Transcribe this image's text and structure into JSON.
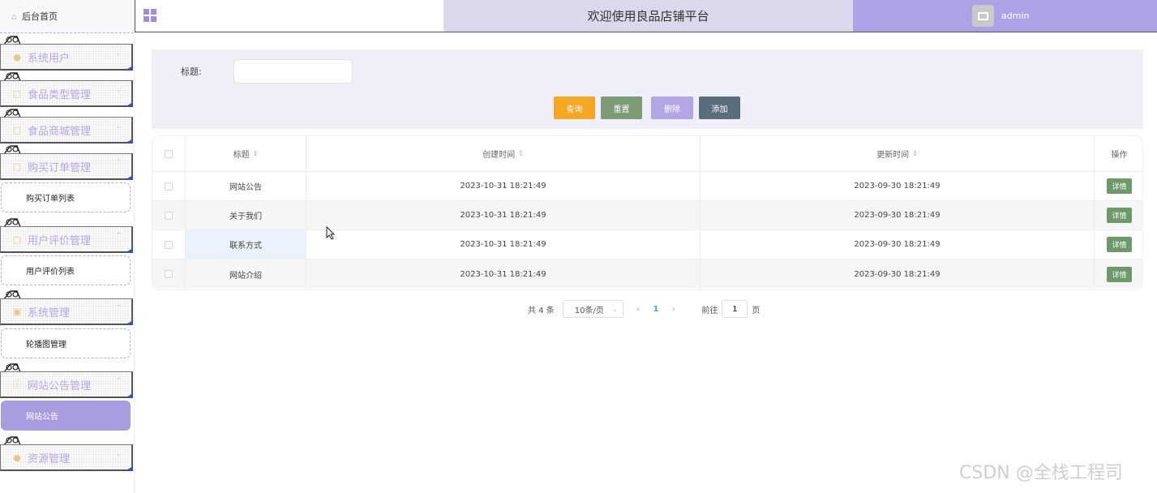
{
  "header": {
    "title": "欢迎使用良品店铺平台",
    "username": "admin"
  },
  "sidebar": {
    "home": "后台首页",
    "menus": [
      {
        "label": "系统用户",
        "icon": "user-icon"
      },
      {
        "label": "食品类型管理",
        "icon": "folder-icon"
      },
      {
        "label": "食品商城管理",
        "icon": "folder-icon"
      },
      {
        "label": "购买订单管理",
        "icon": "folder-icon",
        "subs": [
          "购买订单列表"
        ]
      },
      {
        "label": "用户评价管理",
        "icon": "folder-icon",
        "subs": [
          "用户评价列表"
        ]
      },
      {
        "label": "系统管理",
        "icon": "picture-icon",
        "subs": [
          "轮播图管理"
        ]
      },
      {
        "label": "网站公告管理",
        "icon": "info-icon",
        "subs": [
          "网站公告"
        ]
      },
      {
        "label": "资源管理",
        "icon": "resource-icon"
      }
    ]
  },
  "search": {
    "label": "标题:",
    "placeholder": "",
    "buttons": {
      "query": "查询",
      "reset": "重置",
      "delete": "删除",
      "add": "添加"
    },
    "colors": {
      "query": "#f5a623",
      "reset": "#7d9b77",
      "delete": "#b2a6e6",
      "add": "#5a6d7a"
    }
  },
  "table": {
    "columns": [
      "标题",
      "创建时间",
      "更新时间",
      "操作"
    ],
    "rows": [
      {
        "title": "网站公告",
        "created": "2023-10-31 18:21:49",
        "updated": "2023-09-30 18:21:49",
        "action": "详情"
      },
      {
        "title": "关于我们",
        "created": "2023-10-31 18:21:49",
        "updated": "2023-09-30 18:21:49",
        "action": "详情"
      },
      {
        "title": "联系方式",
        "created": "2023-10-31 18:21:49",
        "updated": "2023-09-30 18:21:49",
        "action": "详情"
      },
      {
        "title": "网站介绍",
        "created": "2023-10-31 18:21:49",
        "updated": "2023-09-30 18:21:49",
        "action": "详情"
      }
    ]
  },
  "pagination": {
    "total": "共 4 条",
    "page_size": "10条/页",
    "current_page": "1",
    "goto_label": "前往",
    "goto_value": "1",
    "page_unit": "页"
  },
  "watermark": "CSDN @全栈工程司"
}
